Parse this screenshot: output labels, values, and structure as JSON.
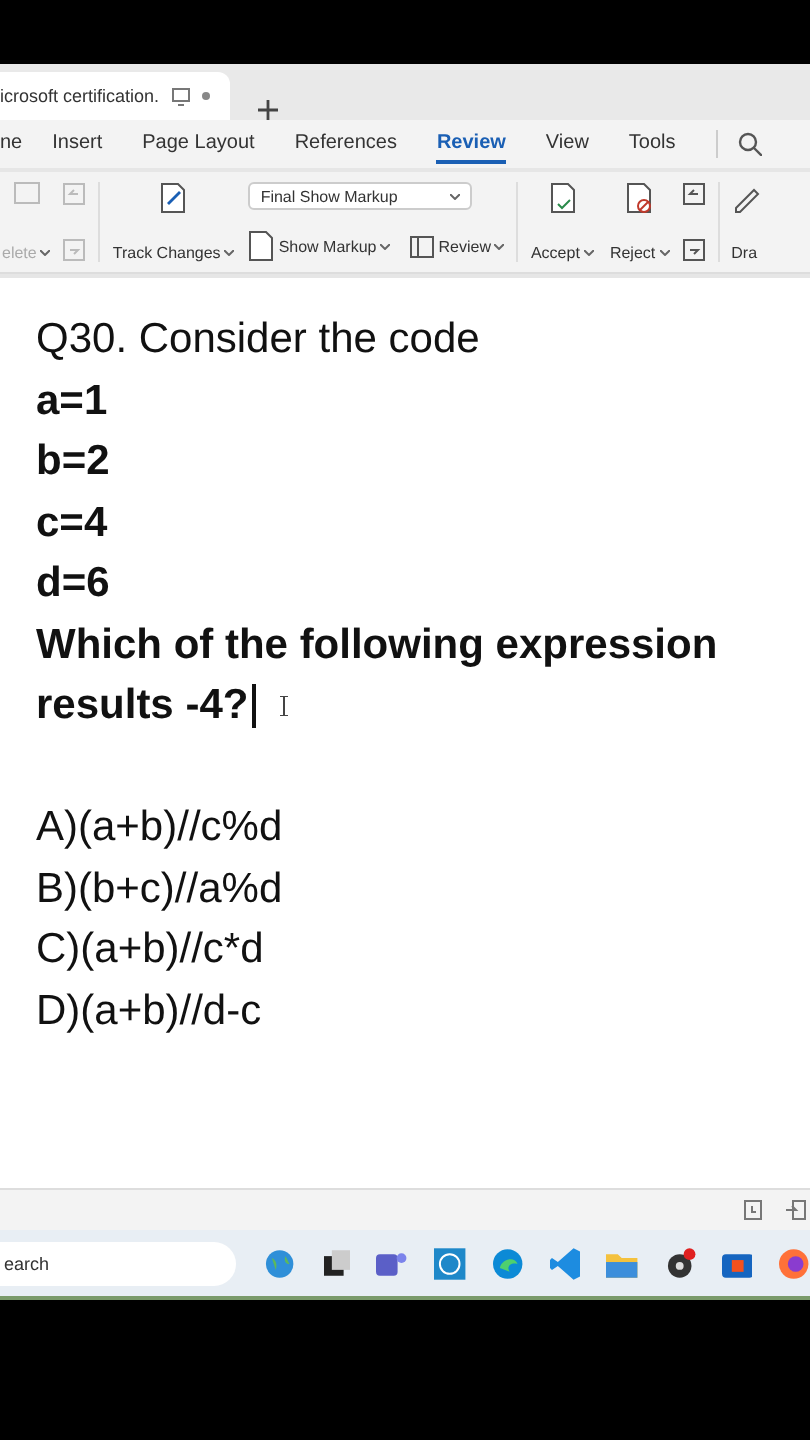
{
  "browser_tab": {
    "title": "icrosoft certification."
  },
  "menu_tabs": [
    {
      "label": "ne",
      "selected": false
    },
    {
      "label": "Insert",
      "selected": false
    },
    {
      "label": "Page Layout",
      "selected": false
    },
    {
      "label": "References",
      "selected": false
    },
    {
      "label": "Review",
      "selected": true
    },
    {
      "label": "View",
      "selected": false
    },
    {
      "label": "Tools",
      "selected": false
    }
  ],
  "ribbon": {
    "delete": {
      "label": "elete",
      "disabled": true
    },
    "track_changes": {
      "label": "Track Changes"
    },
    "markup_mode": {
      "value": "Final Show Markup"
    },
    "show_markup": {
      "label": "Show Markup"
    },
    "review": {
      "label": "Review"
    },
    "accept": {
      "label": "Accept"
    },
    "reject": {
      "label": "Reject"
    },
    "draw": {
      "label": "Dra"
    }
  },
  "document": {
    "paragraphs": [
      [
        "Q30. Consider the  code",
        "a=1",
        "b=2",
        "c=4",
        "d=6",
        "Which of the following expression",
        "results -4?"
      ],
      [
        "A)(a+b)//c%d",
        "B)(b+c)//a%d",
        "C)(a+b)//c*d",
        "D)(a+b)//d-c"
      ]
    ]
  },
  "taskbar": {
    "search": {
      "placeholder": "earch"
    }
  }
}
